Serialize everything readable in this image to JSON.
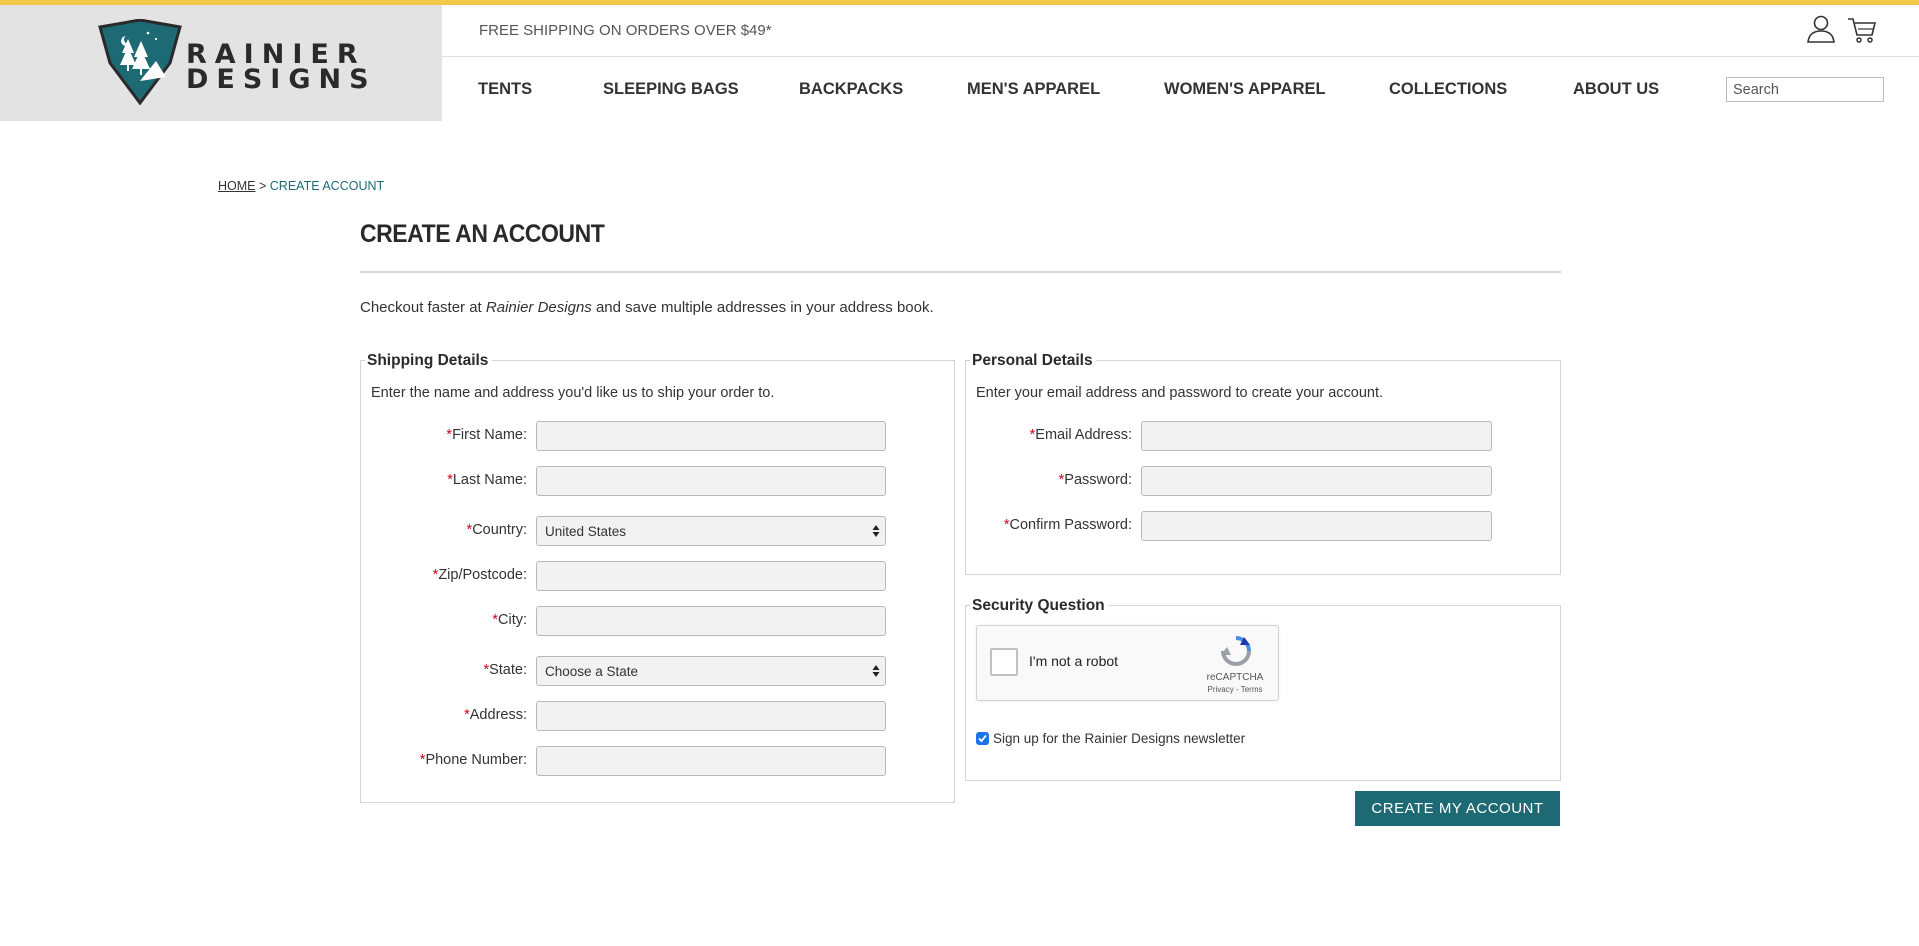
{
  "colors": {
    "accent_bar": "#f4c94a",
    "brand_teal": "#1e6a74",
    "required": "#d0021b"
  },
  "header": {
    "logo_line1": "RAINIER",
    "logo_line2": "DESIGNS",
    "shipping_note": "FREE SHIPPING ON ORDERS OVER $49*",
    "account_icon": "user-icon",
    "cart_icon": "cart-icon",
    "search_placeholder": "Search"
  },
  "nav": {
    "items": [
      "TENTS",
      "SLEEPING BAGS",
      "BACKPACKS",
      "MEN'S APPAREL",
      "WOMEN'S APPAREL",
      "COLLECTIONS",
      "ABOUT US"
    ]
  },
  "breadcrumb": {
    "home": "HOME",
    "separator": ">",
    "current": "CREATE ACCOUNT"
  },
  "page": {
    "title": "CREATE AN ACCOUNT",
    "intro_before": "Checkout faster at ",
    "intro_brand": "Rainier Designs",
    "intro_after": " and save multiple addresses in your address book."
  },
  "shipping": {
    "legend": "Shipping Details",
    "description": "Enter the name and address you'd like us to ship your order to.",
    "required_mark": "*",
    "first_name_label": "First Name:",
    "last_name_label": "Last Name:",
    "country_label": "Country:",
    "country_value": "United States",
    "zip_label": "Zip/Postcode:",
    "city_label": "City:",
    "state_label": "State:",
    "state_value": "Choose a State",
    "address_label": "Address:",
    "phone_label": "Phone Number:"
  },
  "personal": {
    "legend": "Personal Details",
    "description": "Enter your email address and password to create your account.",
    "email_label": "Email Address:",
    "password_label": "Password:",
    "confirm_label": "Confirm Password:"
  },
  "security": {
    "legend": "Security Question",
    "captcha_text": "I'm not a robot",
    "captcha_brand": "reCAPTCHA",
    "captcha_links": "Privacy - Terms",
    "newsletter_label": "Sign up for the Rainier Designs newsletter",
    "newsletter_checked": true
  },
  "submit_label": "CREATE MY ACCOUNT"
}
